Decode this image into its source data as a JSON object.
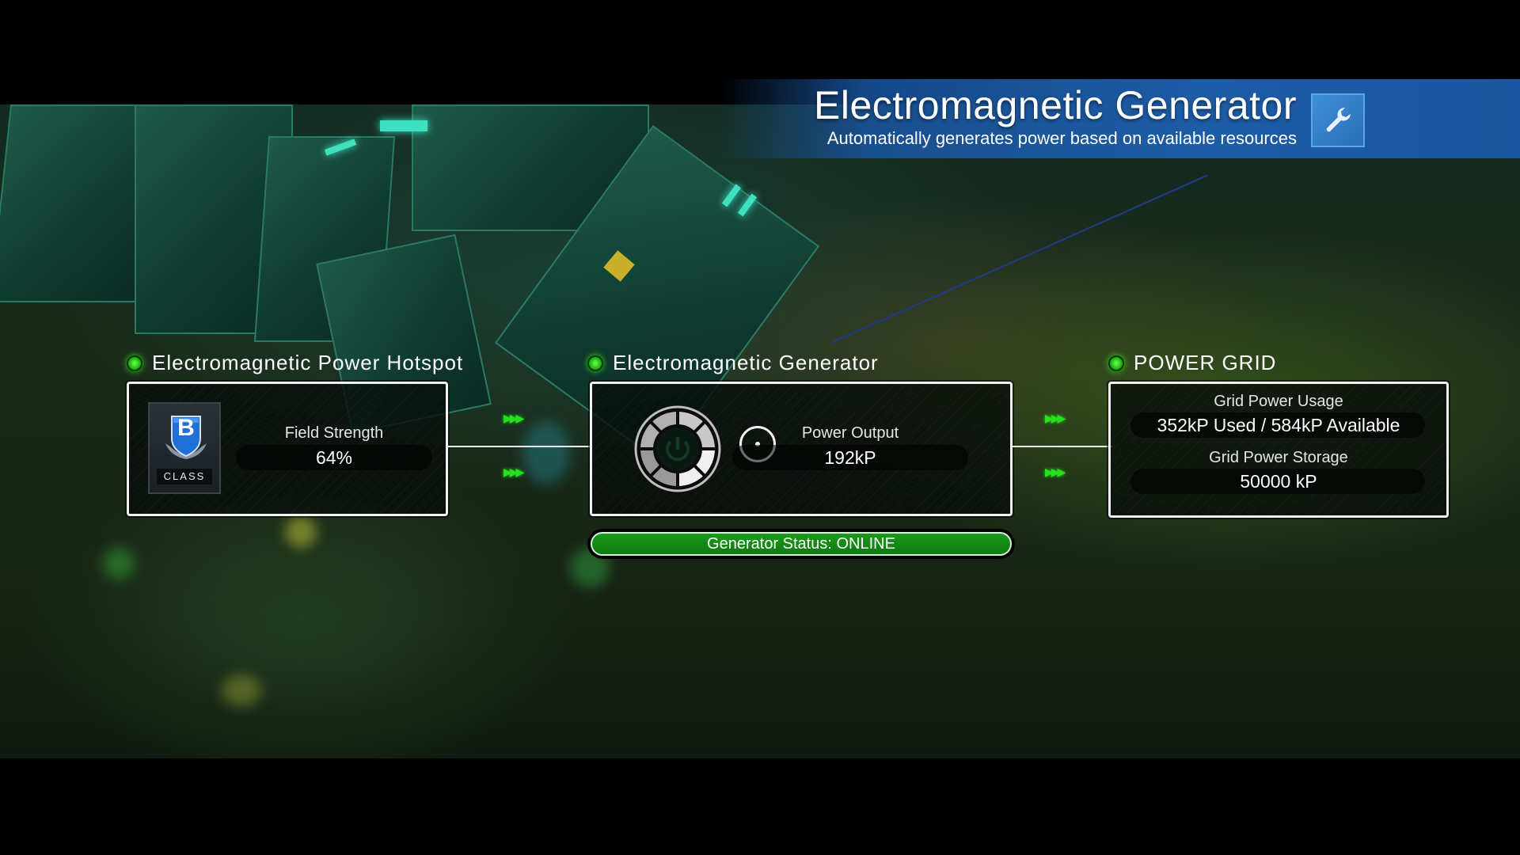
{
  "header": {
    "title": "Electromagnetic Generator",
    "subtitle": "Automatically generates power based on available resources",
    "icon": "wrench-icon"
  },
  "hotspot": {
    "label": "Electromagnetic Power Hotspot",
    "class_letter": "B",
    "class_caption": "CLASS",
    "stat_label": "Field Strength",
    "stat_value": "64%"
  },
  "generator": {
    "label": "Electromagnetic Generator",
    "stat_label": "Power Output",
    "stat_value": "192kP",
    "status_text": "Generator Status: ONLINE",
    "power_icon": "power-button-icon"
  },
  "grid": {
    "label": "POWER GRID",
    "usage_label": "Grid Power Usage",
    "usage_value": "352kP Used / 584kP Available",
    "storage_label": "Grid Power Storage",
    "storage_value": "50000 kP"
  },
  "colors": {
    "status_green": "#2ecc1c",
    "header_blue": "#1d5ca6",
    "online_bar": "#0e7a0e"
  }
}
